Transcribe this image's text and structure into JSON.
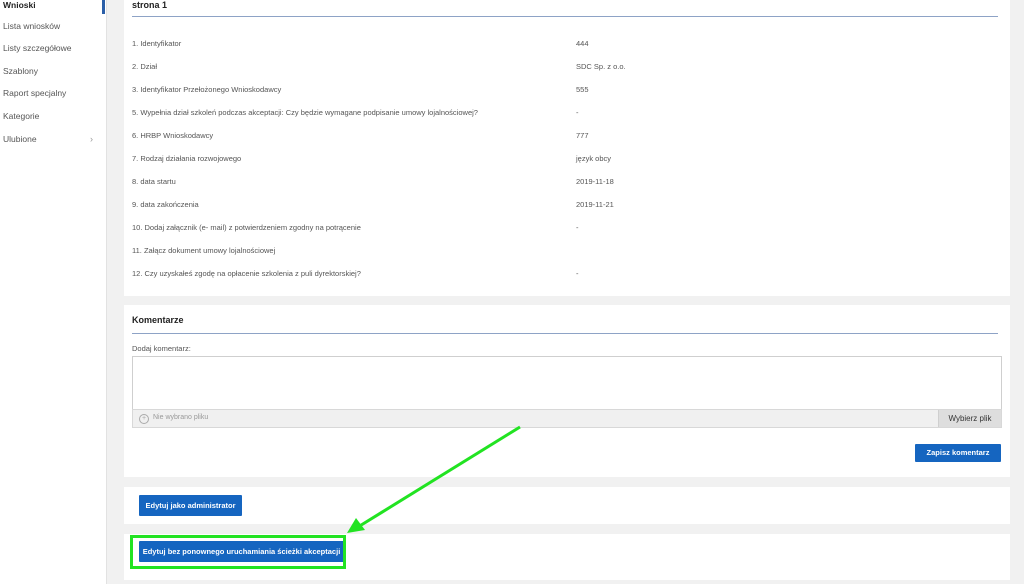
{
  "sidebar": {
    "items": [
      {
        "label": "Wnioski"
      },
      {
        "label": "Lista wniosków"
      },
      {
        "label": "Listy szczegółowe"
      },
      {
        "label": "Szablony"
      },
      {
        "label": "Raport specjalny"
      },
      {
        "label": "Kategorie"
      },
      {
        "label": "Ulubione"
      }
    ],
    "chevron": "›"
  },
  "details": {
    "title": "strona 1",
    "rows": [
      {
        "label": "1. Identyfikator",
        "value": "444"
      },
      {
        "label": "2. Dział",
        "value": "SDC Sp. z o.o."
      },
      {
        "label": "3. Identyfikator Przełożonego Wnioskodawcy",
        "value": "555"
      },
      {
        "label": "5. Wypełnia dział szkoleń podczas akceptacji: Czy będzie wymagane podpisanie umowy lojalnościowej?",
        "value": "-"
      },
      {
        "label": "6. HRBP Wnioskodawcy",
        "value": "777"
      },
      {
        "label": "7. Rodzaj działania rozwojowego",
        "value": "język obcy"
      },
      {
        "label": "8. data startu",
        "value": "2019-11-18"
      },
      {
        "label": "9. data zakończenia",
        "value": "2019-11-21"
      },
      {
        "label": "10. Dodaj załącznik (e- mail) z potwierdzeniem zgodny na potrącenie",
        "value": "-"
      },
      {
        "label": "11. Załącz dokument umowy lojalnościowej",
        "value": ""
      },
      {
        "label": "12. Czy uzyskałeś zgodę na opłacenie szkolenia z puli dyrektorskiej?",
        "value": "-"
      }
    ]
  },
  "comments": {
    "title": "Komentarze",
    "add_label": "Dodaj komentarz:",
    "file_placeholder": "Nie wybrano pliku",
    "choose_file": "Wybierz plik",
    "save": "Zapisz komentarz"
  },
  "actions": {
    "edit_admin": "Edytuj jako administrator",
    "edit_no_restart": "Edytuj bez ponownego uruchamiania ścieżki akceptacji"
  },
  "colors": {
    "primary": "#1565c0",
    "highlight": "#22e322",
    "rule": "#8ea3c6"
  }
}
